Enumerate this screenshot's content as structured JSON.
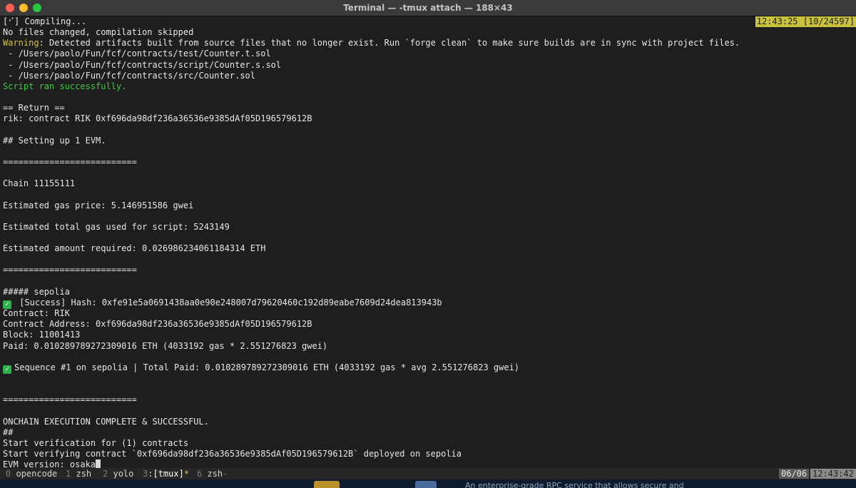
{
  "window": {
    "title": "Terminal — -tmux attach — 188×43"
  },
  "terminal": {
    "clock": "12:43:25 [10/24597]",
    "lines": [
      "[⠊] Compiling...",
      "No files changed, compilation skipped",
      {
        "warn": "Warning",
        "rest": ": Detected artifacts built from source files that no longer exist. Run `forge clean` to make sure builds are in sync with project files."
      },
      " - /Users/paolo/Fun/fcf/contracts/test/Counter.t.sol",
      " - /Users/paolo/Fun/fcf/contracts/script/Counter.s.sol",
      " - /Users/paolo/Fun/fcf/contracts/src/Counter.sol",
      "Script ran successfully.",
      "",
      "== Return ==",
      "rik: contract RIK 0xf696da98df236a36536e9385dAf05D196579612B",
      "",
      "## Setting up 1 EVM.",
      "",
      "==========================",
      "",
      "Chain 11155111",
      "",
      "Estimated gas price: 5.146951586 gwei",
      "",
      "Estimated total gas used for script: 5243149",
      "",
      "Estimated amount required: 0.026986234061184314 ETH",
      "",
      "==========================",
      "",
      "##### sepolia",
      " [Success] Hash: 0xfe91e5a0691438aa0e90e248007d79620460c192d89eabe7609d24dea813943b",
      "Contract: RIK",
      "Contract Address: 0xf696da98df236a36536e9385dAf05D196579612B",
      "Block: 11001413",
      "Paid: 0.010289789272309016 ETH (4033192 gas * 2.551276823 gwei)",
      "",
      "Sequence #1 on sepolia | Total Paid: 0.010289789272309016 ETH (4033192 gas * avg 2.551276823 gwei)",
      "",
      "",
      "==========================",
      "",
      "ONCHAIN EXECUTION COMPLETE & SUCCESSFUL.",
      "##",
      "Start verification for (1) contracts",
      "Start verifying contract `0xf696da98df236a36536e9385dAf05D196579612B` deployed on sepolia",
      "EVM version: osaka"
    ]
  },
  "tmux": {
    "windows": [
      {
        "index": "0",
        "name": "opencode",
        "flag": ""
      },
      {
        "index": "1",
        "name": "zsh",
        "flag": ""
      },
      {
        "index": "2",
        "name": "yolo",
        "flag": ""
      },
      {
        "index": "3",
        "name": "[tmux]",
        "flag": "*"
      },
      {
        "index": "6",
        "name": "zsh",
        "flag": "-"
      }
    ],
    "date": "06/06",
    "time": "12:43:42"
  },
  "background_window": {
    "text": "An enterprise-grade RPC service that allows secure and"
  },
  "colors": {
    "warning": "#d6c13c",
    "success": "#3fc93f",
    "clock_bg": "#c9c23a",
    "check_bg": "#2fb24c"
  }
}
